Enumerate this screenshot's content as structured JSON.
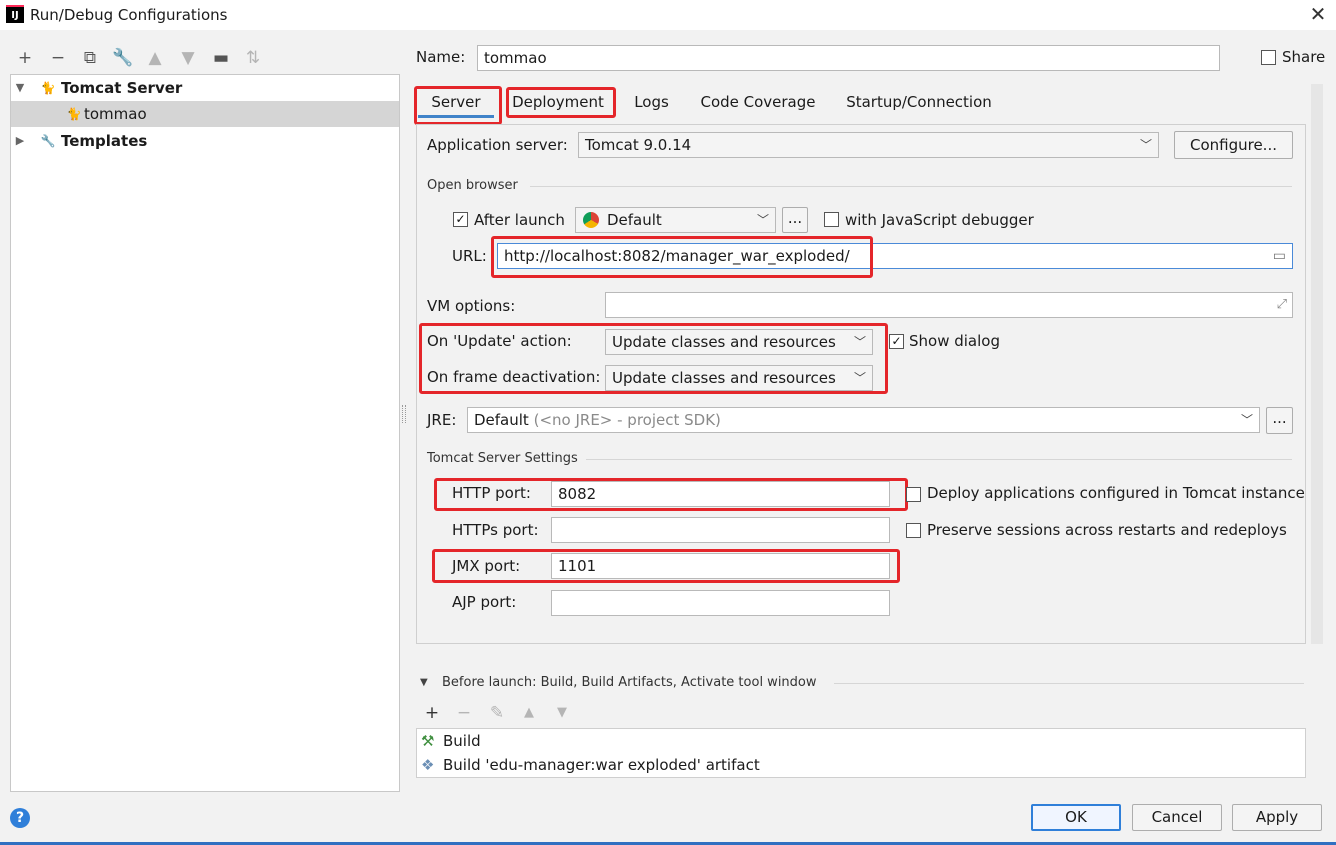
{
  "window": {
    "title": "Run/Debug Configurations",
    "app_icon": "IJ"
  },
  "left_toolbar": {
    "icons": [
      "add-icon",
      "remove-icon",
      "copy-icon",
      "wrench-icon",
      "move-up-icon",
      "move-down-icon",
      "folder-icon",
      "sort-icon"
    ]
  },
  "tree": {
    "items": [
      {
        "label": "Tomcat Server",
        "expanded": true
      },
      {
        "label": "tommao",
        "selected": true
      },
      {
        "label": "Templates",
        "expanded": false
      }
    ]
  },
  "name_field": {
    "label": "Name:",
    "value": "tommao"
  },
  "share": {
    "label": "Share",
    "checked": false
  },
  "tabs": [
    {
      "label": "Server",
      "active": true
    },
    {
      "label": "Deployment"
    },
    {
      "label": "Logs"
    },
    {
      "label": "Code Coverage"
    },
    {
      "label": "Startup/Connection"
    }
  ],
  "server": {
    "app_server_label": "Application server:",
    "app_server_value": "Tomcat 9.0.14",
    "configure_label": "Configure...",
    "open_browser_title": "Open browser",
    "after_launch_label": "After launch",
    "after_launch_checked": true,
    "browser_value": "Default",
    "browse_label": "...",
    "js_debugger_label": "with JavaScript debugger",
    "url_label": "URL:",
    "url_value": "http://localhost:8082/manager_war_exploded/",
    "vm_options_label": "VM options:",
    "vm_options_value": "",
    "on_update_label": "On 'Update' action:",
    "on_update_value": "Update classes and resources",
    "show_dialog_label": "Show dialog",
    "show_dialog_checked": true,
    "on_frame_label": "On frame deactivation:",
    "on_frame_value": "Update classes and resources",
    "jre_label": "JRE:",
    "jre_value": "Default",
    "jre_hint": "(<no JRE> - project SDK)",
    "jre_browse_label": "...",
    "tomcat_settings_title": "Tomcat Server Settings",
    "http_port_label": "HTTP port:",
    "http_port_value": "8082",
    "https_port_label": "HTTPs port:",
    "https_port_value": "",
    "jmx_port_label": "JMX port:",
    "jmx_port_value": "1101",
    "ajp_port_label": "AJP port:",
    "ajp_port_value": "",
    "deploy_label": "Deploy applications configured in Tomcat instance",
    "preserve_label": "Preserve sessions across restarts and redeploys"
  },
  "before_launch": {
    "title": "Before launch: Build, Build Artifacts, Activate tool window",
    "items": [
      "Build",
      "Build 'edu-manager:war exploded' artifact"
    ]
  },
  "buttons": {
    "ok": "OK",
    "cancel": "Cancel",
    "apply": "Apply"
  },
  "colors": {
    "highlight": "#e4262a",
    "accent": "#2f7fd9"
  }
}
